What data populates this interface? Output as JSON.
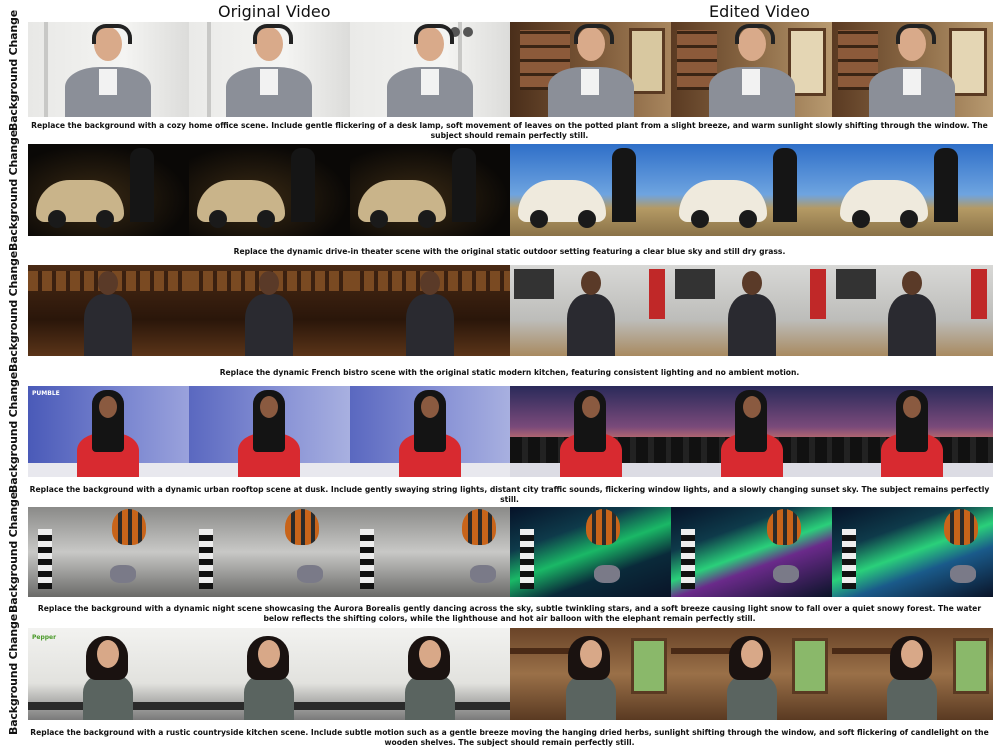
{
  "headers": {
    "original": "Original Video",
    "edited": "Edited Video"
  },
  "rows": [
    {
      "label": "Background Change",
      "caption": "Replace the background with a cozy home office scene. Include gentle flickering of a desk lamp, soft movement of leaves on the potted plant from a slight breeze, and warm sunlight slowly shifting through the window. The subject should remain perfectly still."
    },
    {
      "label": "Background Change",
      "caption": "Replace the dynamic drive-in theater scene with the original static outdoor setting featuring a clear blue sky and still dry grass."
    },
    {
      "label": "Background Change",
      "caption": "Replace the dynamic French bistro scene with the original static modern kitchen, featuring consistent lighting and no ambient motion."
    },
    {
      "label": "Background Change",
      "caption": "Replace the background with a dynamic urban rooftop scene at dusk. Include gently swaying string lights, distant city traffic sounds, flickering window lights, and a slowly changing sunset sky. The subject remains perfectly still."
    },
    {
      "label": "Background Change",
      "caption": "Replace the background with a dynamic night scene showcasing the Aurora Borealis gently dancing across the sky, subtle twinkling stars, and a soft breeze causing light snow to fall over a quiet snowy forest. The water below reflects the shifting colors, while the lighthouse and hot air balloon with the elephant remain perfectly still."
    },
    {
      "label": "Background Change",
      "caption": "Replace the background with a rustic countryside kitchen scene. Include subtle motion such as a gentle breeze moving the hanging dried herbs, sunlight shifting through the window, and soft flickering of candlelight on the wooden shelves. The subject should remain perfectly still."
    }
  ],
  "frame_text": {
    "row4_logo": "PUMBLE",
    "row6_logo": "Pepper"
  }
}
